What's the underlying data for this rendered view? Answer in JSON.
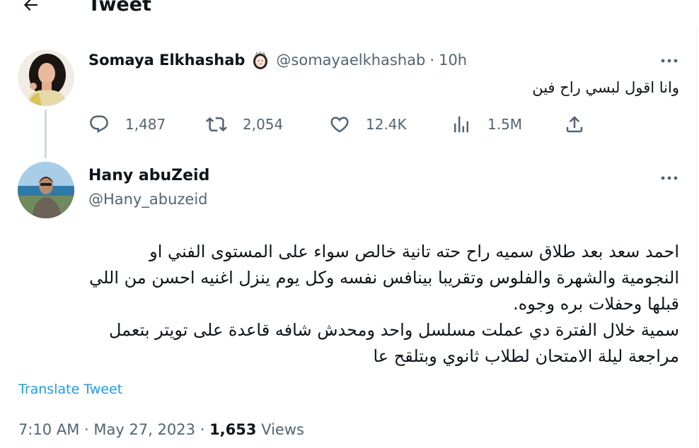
{
  "header": {
    "title": "Tweet"
  },
  "parent_tweet": {
    "name": "Somaya Elkhashab",
    "handle": "@somayaelkhashab",
    "separator": "·",
    "time": "10h",
    "text": "وانا اقول لبسي راح فين",
    "stats": {
      "replies": "1,487",
      "retweets": "2,054",
      "likes": "12.4K",
      "views": "1.5M"
    }
  },
  "main_tweet": {
    "name": "Hany abuZeid",
    "handle": "@Hany_abuzeid",
    "lines": [
      "احمد سعد بعد طلاق سميه راح حته تانية خالص سواء على المستوى الفني او",
      "النجومية والشهرة والفلوس وتقريبا بينافس نفسه وكل يوم ينزل اغنيه احسن من اللي",
      "قبلها وحفلات بره وجوه.",
      "سمية خلال الفترة دي عملت مسلسل واحد  ومحدش شافه قاعدة على تويتر بتعمل",
      "مراجعة ليلة الامتحان لطلاب ثانوي وبتلقح عا"
    ],
    "translate_label": "Translate Tweet",
    "time": "7:10 AM",
    "separator": "·",
    "date": "May 27, 2023",
    "views_count": "1,653",
    "views_label": "Views"
  },
  "icons": {
    "back": "arrow-left-icon",
    "badge": "emoji-woman-icon",
    "more": "more-horizontal-icon",
    "reply": "reply-icon",
    "retweet": "retweet-icon",
    "like": "heart-icon",
    "views": "analytics-icon",
    "share": "share-icon"
  },
  "colors": {
    "text": "#0f1419",
    "secondary": "#536471",
    "link": "#1d9bf0",
    "thread_line": "#cfd9de"
  }
}
